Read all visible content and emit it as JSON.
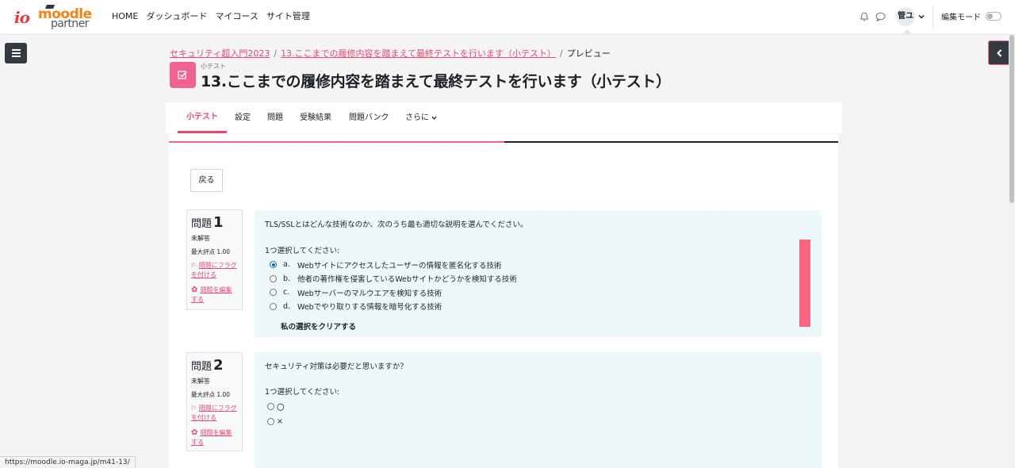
{
  "nav": {
    "logo": "io moodle partner",
    "links": [
      "HOME",
      "ダッシュボード",
      "マイコース",
      "サイト管理"
    ],
    "user_initials": "管ユ",
    "edit_mode_label": "編集モード"
  },
  "breadcrumb": {
    "course": "セキュリティ超入門2023",
    "activity": "13.ここまでの履修内容を踏まえて最終テストを行います（小テスト）",
    "current": "プレビュー"
  },
  "header": {
    "module_type": "小テスト",
    "title": "13.ここまでの履修内容を踏まえて最終テストを行います（小テスト）"
  },
  "tabs": [
    "小テスト",
    "設定",
    "問題",
    "受験結果",
    "問題バンク",
    "さらに"
  ],
  "back_button": "戻る",
  "questions": [
    {
      "label": "問題",
      "number": "1",
      "state": "未解答",
      "grade": "最大評点 1.00",
      "flag": "問題にフラグを付ける",
      "edit": "問題を編集する",
      "text": "TLS/SSLとはどんな技術なのか、次のうち最も適切な説明を選んでください。",
      "prompt": "1つ選択してください:",
      "answers": [
        {
          "letter": "a.",
          "text": "Webサイトにアクセスしたユーザーの情報を匿名化する技術",
          "checked": true
        },
        {
          "letter": "b.",
          "text": "他者の著作権を侵害しているWebサイトかどうかを検知する技術",
          "checked": false
        },
        {
          "letter": "c.",
          "text": "Webサーバーのマルウエアを検知する技術",
          "checked": false
        },
        {
          "letter": "d.",
          "text": "Webでやり取りする情報を暗号化する技術",
          "checked": false
        }
      ],
      "clear": "私の選択をクリアする"
    },
    {
      "label": "問題",
      "number": "2",
      "state": "未解答",
      "grade": "最大評点 1.00",
      "flag": "問題にフラグを付ける",
      "edit": "問題を編集する",
      "text": "セキュリティ対策は必要だと思いますか？",
      "prompt": "1つ選択してください:",
      "answers": [
        {
          "text": "〇",
          "checked": false
        },
        {
          "text": "×",
          "checked": false
        }
      ]
    }
  ],
  "status_url": "https://moodle.io-maga.jp/m41-13/",
  "colors": {
    "accent": "#e8496f",
    "icon_bg": "#f06292",
    "question_bg": "#eef7fa",
    "flag_bar": "#ff6581"
  }
}
